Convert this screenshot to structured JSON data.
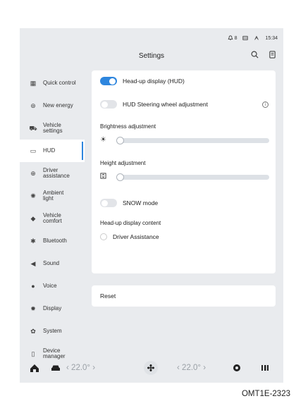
{
  "status": {
    "bell": "8",
    "battery": "",
    "bluetooth": "",
    "time": "15:34"
  },
  "header": {
    "title": "Settings"
  },
  "sidebar": {
    "items": [
      {
        "label": "Quick control",
        "icon": "quick-control-icon"
      },
      {
        "label": "New energy",
        "icon": "new-energy-icon"
      },
      {
        "label": "Vehicle\nsettings",
        "icon": "car-icon"
      },
      {
        "label": "HUD",
        "icon": "hud-icon",
        "active": true
      },
      {
        "label": "Driver\nassistance",
        "icon": "steering-icon"
      },
      {
        "label": "Ambient\nlight",
        "icon": "sun-icon"
      },
      {
        "label": "Vehicle\ncomfort",
        "icon": "leaf-icon"
      },
      {
        "label": "Bluetooth",
        "icon": "bluetooth-icon"
      },
      {
        "label": "Sound",
        "icon": "speaker-icon"
      },
      {
        "label": "Voice",
        "icon": "mic-icon"
      },
      {
        "label": "Display",
        "icon": "display-icon"
      },
      {
        "label": "System",
        "icon": "gear-icon"
      },
      {
        "label": "Device\nmanager",
        "icon": "device-icon"
      }
    ]
  },
  "hud": {
    "hud_toggle_label": "Head-up display (HUD)",
    "steering_label": "HUD Steering wheel adjustment",
    "brightness_label": "Brightness adjustment",
    "brightness_value": 0,
    "height_label": "Height adjustment",
    "height_value": 0,
    "snow_label": "SNOW mode",
    "content_label": "Head-up display content",
    "driver_assist_label": "Driver Assistance"
  },
  "reset": {
    "label": "Reset"
  },
  "bottom": {
    "temp_left": "22.0°",
    "temp_right": "22.0°"
  },
  "caption": "OMT1E-2323",
  "colors": {
    "accent": "#2e86de",
    "background": "#e9ebee",
    "panel": "#ffffff"
  }
}
